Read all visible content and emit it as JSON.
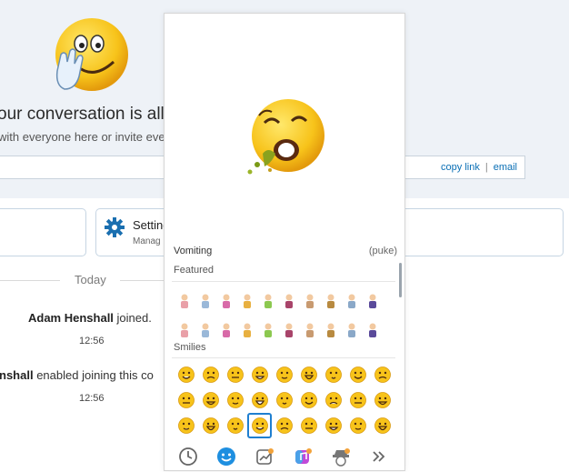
{
  "conversation": {
    "title": "our conversation is all se",
    "subtitle": "with everyone here or invite eve",
    "copy_link": "copy link",
    "separator": "|",
    "email": "email"
  },
  "settings_card": {
    "title": "Setting",
    "subtitle": "Manag"
  },
  "chat": {
    "date_divider": "Today",
    "messages": [
      {
        "name": "Adam Henshall",
        "text": "joined.",
        "time": "12:56"
      },
      {
        "name": "nshall",
        "text": "enabled joining this co",
        "time": "12:56"
      }
    ]
  },
  "emoji_picker": {
    "preview": {
      "name": "Vomiting",
      "shortcut": "(puke)",
      "icon": "vomiting-emoji"
    },
    "sections": [
      {
        "label": "Featured",
        "count": 20
      },
      {
        "label": "Smilies",
        "count": 27
      }
    ],
    "selected_smiley": "vomiting-emoji",
    "tabs": [
      "recent-icon",
      "smiley-icon",
      "trending-icon",
      "media-apps-icon",
      "hat-icon",
      "more-icon"
    ],
    "active_tab": "smiley-icon"
  },
  "colors": {
    "accent": "#0a6fb5",
    "selection": "#1f7fd0",
    "emoji_yellow": "#f7c31a",
    "banner_bg": "#eef2f7"
  }
}
